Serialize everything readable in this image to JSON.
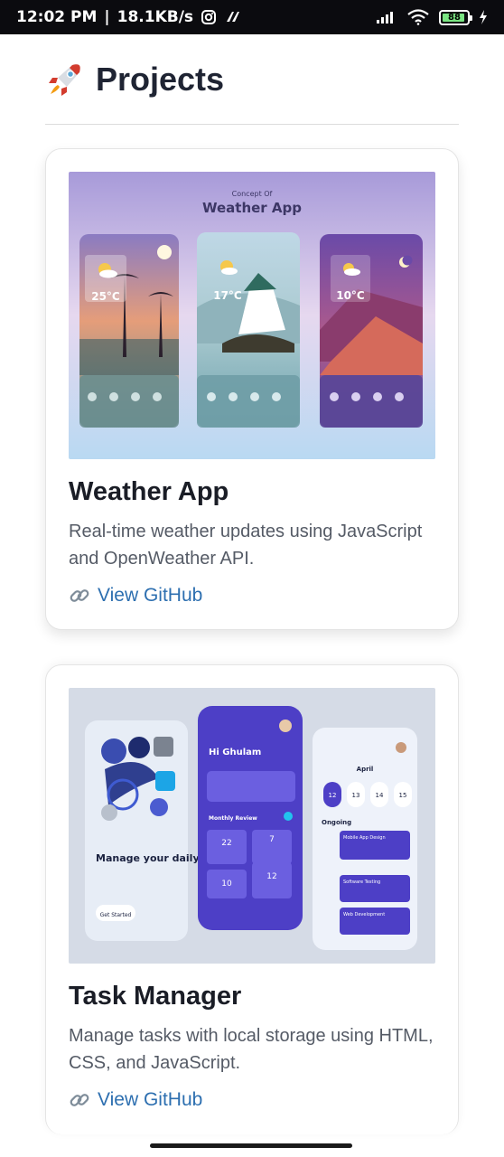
{
  "status_bar": {
    "time": "12:02 PM",
    "separator": "|",
    "net_speed": "18.1KB/s",
    "battery_level": "88"
  },
  "header": {
    "icon": "rocket-icon",
    "title": "Projects"
  },
  "projects": [
    {
      "title": "Weather App",
      "description": "Real-time weather updates using JavaScript and OpenWeather API.",
      "link_label": "View GitHub",
      "thumb": {
        "heading_small": "Concept Of",
        "heading": "Weather App",
        "temps": [
          "25°C",
          "17°C",
          "10°C"
        ]
      }
    },
    {
      "title": "Task Manager",
      "description": "Manage tasks with local storage using HTML, CSS, and JavaScript.",
      "link_label": "View GitHub",
      "thumb": {
        "headline": "Manage your daily tasks",
        "cta": "Get Started",
        "greeting": "Hi Ghulam",
        "section": "Monthly Review",
        "stats": [
          "22",
          "7",
          "10",
          "12"
        ],
        "month": "April",
        "days": [
          "12",
          "13",
          "14",
          "15"
        ],
        "ongoing": "Ongoing",
        "tasks": [
          "Mobile App Design",
          "Software Testing",
          "Web Development"
        ]
      }
    }
  ],
  "colors": {
    "title": "#1f2433",
    "link": "#2d6fb0",
    "text_muted": "#555b66"
  }
}
